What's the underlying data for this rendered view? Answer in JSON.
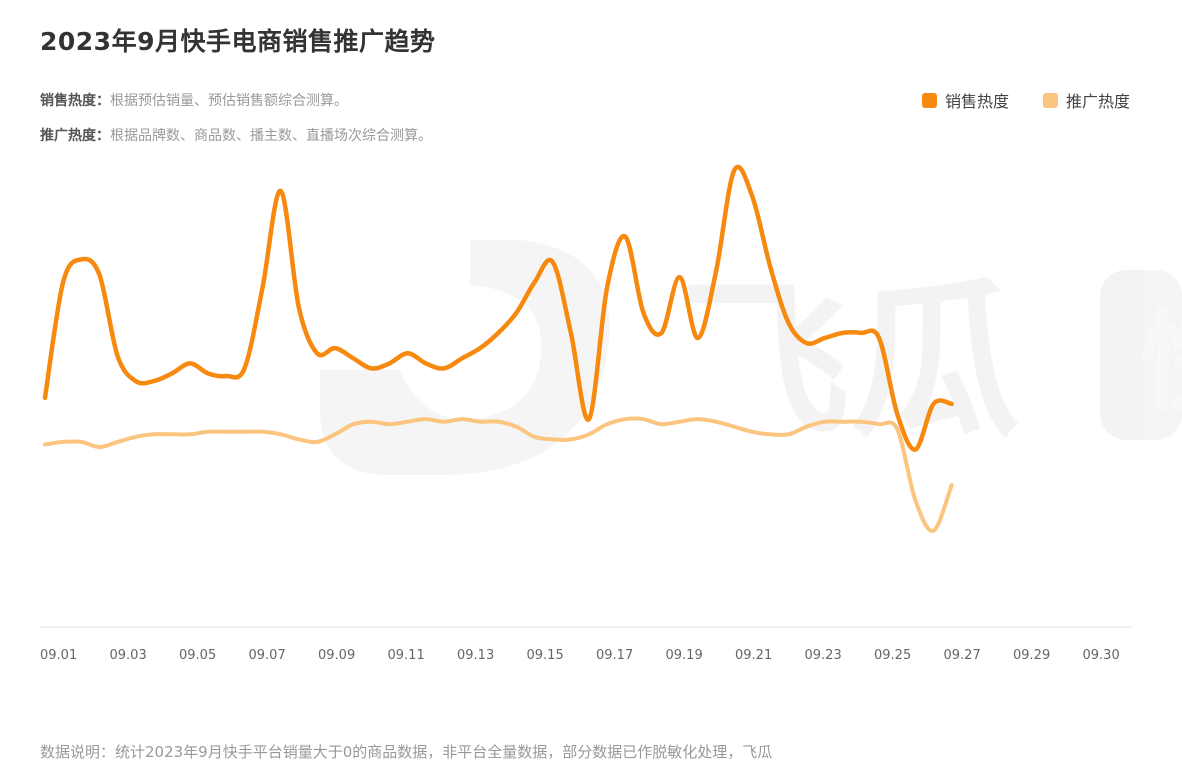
{
  "header": {
    "title": "2023年9月快手电商销售推广趋势",
    "note1_key": "销售热度：",
    "note1_text": "根据预估销量、预估销售额综合测算。",
    "note2_key": "推广热度：",
    "note2_text": "根据品牌数、商品数、播主数、直播场次综合测算。"
  },
  "footer": {
    "text": "数据说明：统计2023年9月快手平台销量大于0的商品数据，非平台全量数据，部分数据已作脱敏化处理，飞瓜"
  },
  "watermark": {
    "logo_text": "飞瓜",
    "side_char": "快"
  },
  "colors": {
    "sales": "#F7890F",
    "promo": "#FBC47F",
    "axis": "#E6E6E6"
  },
  "chart_data": {
    "type": "line",
    "x_ticks": [
      "09.01",
      "09.03",
      "09.05",
      "09.07",
      "09.09",
      "09.11",
      "09.13",
      "09.15",
      "09.17",
      "09.19",
      "09.21",
      "09.23",
      "09.25",
      "09.27",
      "09.29",
      "09.30"
    ],
    "x": [
      1,
      1.5,
      2,
      2.5,
      3,
      3.5,
      4,
      4.5,
      5,
      5.5,
      6,
      6.5,
      7,
      7.5,
      8,
      8.5,
      9,
      9.5,
      10,
      10.5,
      11,
      11.5,
      12,
      12.5,
      13,
      13.5,
      14,
      14.5,
      15,
      15.5,
      16,
      16.5,
      17,
      17.5,
      18,
      18.5,
      19,
      19.5,
      20,
      20.5,
      21,
      21.5,
      22,
      22.5,
      23,
      23.5,
      24,
      24.5,
      25,
      25.5,
      26,
      26.5,
      27,
      27.5,
      28,
      28.5,
      29,
      29.5,
      30,
      30.5,
      31
    ],
    "ylim": [
      0,
      100
    ],
    "grid": false,
    "legend": "top-right",
    "series": [
      {
        "name": "销售热度",
        "values": [
          45.2,
          68,
          72.5,
          69.5,
          53.5,
          48.5,
          48.5,
          50,
          52,
          50,
          49.5,
          51,
          67,
          86,
          63,
          54,
          55,
          53,
          51,
          52,
          54,
          52,
          51,
          53,
          55,
          58,
          62,
          68,
          72,
          58,
          41,
          67,
          77,
          62,
          58,
          69,
          57,
          70,
          90,
          85,
          71,
          60,
          56,
          57,
          58,
          58,
          57,
          42,
          35,
          44,
          44
        ]
      },
      {
        "name": "推广热度",
        "values": [
          36,
          36.5,
          36.5,
          35.5,
          36.5,
          37.5,
          38,
          38,
          38,
          38.5,
          38.5,
          38.5,
          38.5,
          38,
          37,
          36.5,
          38,
          40,
          40.5,
          40,
          40.5,
          41,
          40.5,
          41,
          40.5,
          40.5,
          39.5,
          37.5,
          37,
          37,
          38,
          40,
          41,
          41,
          40,
          40.5,
          41,
          40.5,
          39.5,
          38.5,
          38,
          38,
          39.5,
          40.5,
          40.5,
          40.5,
          40,
          39,
          25,
          19,
          28
        ]
      }
    ]
  }
}
